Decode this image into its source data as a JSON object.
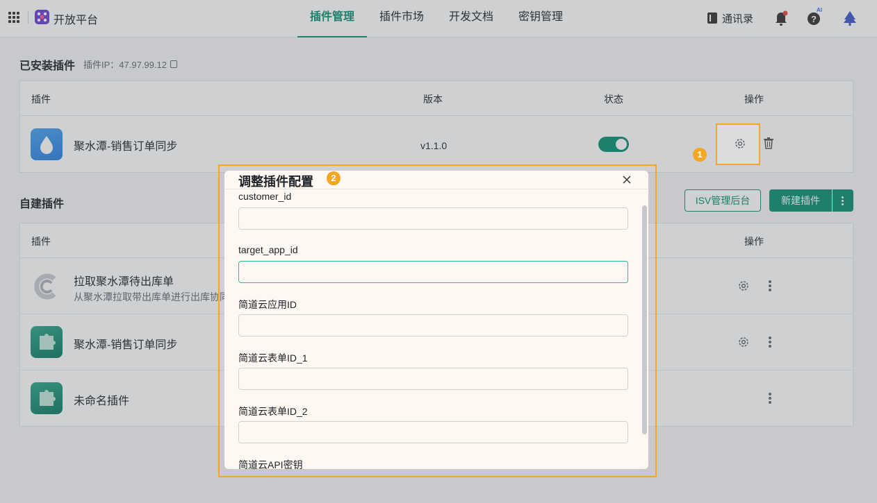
{
  "header": {
    "brand": "开放平台",
    "tabs": [
      {
        "label": "插件管理",
        "active": true
      },
      {
        "label": "插件市场"
      },
      {
        "label": "开发文档"
      },
      {
        "label": "密钥管理"
      }
    ],
    "contacts_label": "通讯录",
    "help_badge": "AI"
  },
  "installed": {
    "title": "已安装插件",
    "ip_label": "插件IP：47.97.99.12",
    "columns": {
      "plugin": "插件",
      "version": "版本",
      "status": "状态",
      "actions": "操作"
    },
    "rows": [
      {
        "name": "聚水潭-销售订单同步",
        "version": "v1.1.0",
        "enabled": true,
        "icon": "water-drop-icon"
      }
    ]
  },
  "custom": {
    "title": "自建插件",
    "isv_button": "ISV管理后台",
    "new_button": "新建插件",
    "columns": {
      "plugin": "插件",
      "actions": "操作"
    },
    "rows": [
      {
        "name": "拉取聚水潭待出库单",
        "desc": "从聚水潭拉取带出库单进行出库协同",
        "icon": "c-logo-icon"
      },
      {
        "name": "聚水潭-销售订单同步",
        "icon": "puzzle-icon"
      },
      {
        "name": "未命名插件",
        "icon": "puzzle-icon"
      }
    ]
  },
  "steps": {
    "one": "1",
    "two": "2"
  },
  "dialog": {
    "title": "调整插件配置",
    "fields": [
      {
        "label": "customer_id",
        "value": ""
      },
      {
        "label": "target_app_id",
        "value": "",
        "focused": true
      },
      {
        "label": "简道云应用ID",
        "value": ""
      },
      {
        "label": "简道云表单ID_1",
        "value": ""
      },
      {
        "label": "简道云表单ID_2",
        "value": ""
      },
      {
        "label": "简道云API密钥",
        "value": ""
      }
    ]
  },
  "colors": {
    "accent": "#0c8f72",
    "highlight": "#f5a623",
    "dialog_bg": "#fff8f2"
  }
}
